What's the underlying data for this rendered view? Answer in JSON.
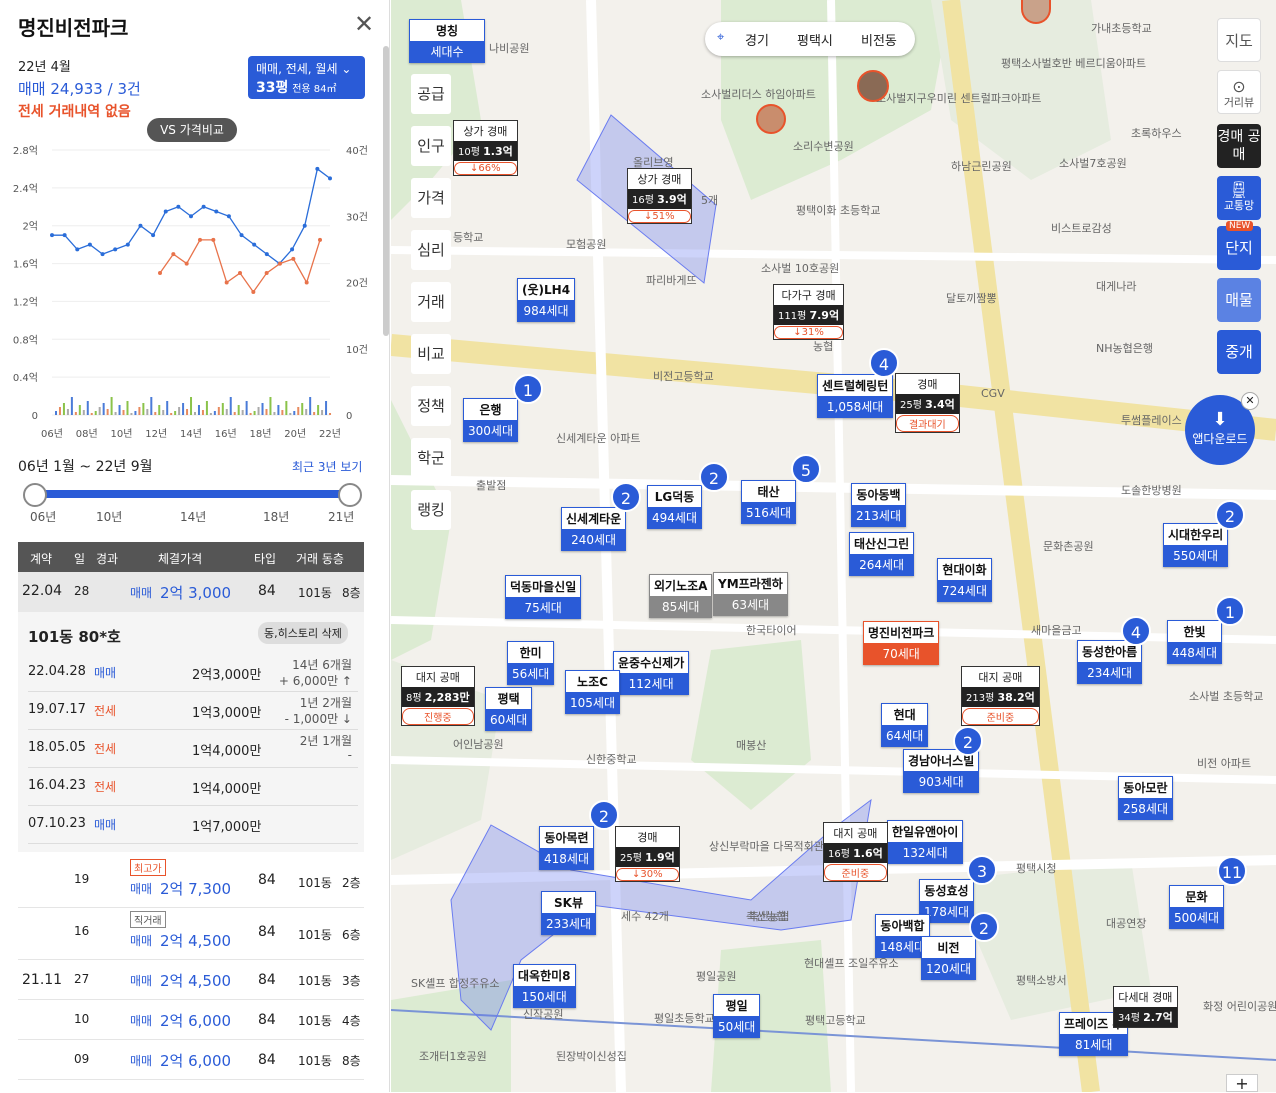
{
  "panel": {
    "title": "명진비전파크",
    "summary": {
      "date": "22년 4월",
      "trade": "매매 24,933 / 3건",
      "lease": "전세 거래내역 없음"
    },
    "typebox": {
      "types": "매매, 전세, 월세",
      "size": "33평",
      "area": "전용 84㎡"
    },
    "vs_button": "VS 가격비교",
    "range": {
      "label": "06년 1월 ~ 22년 9월",
      "link": "최근 3년 보기",
      "ticks": [
        "06년",
        "10년",
        "14년",
        "18년",
        "21년"
      ]
    },
    "table_headers": [
      "계약",
      "일",
      "경과",
      "체결가격",
      "타입",
      "거래 동층"
    ],
    "selected_row": {
      "month": "22.04",
      "day": "28",
      "type": "매매",
      "price": "2억 3,000",
      "size": "84",
      "dong": "101동",
      "floor": "8층"
    },
    "detail": {
      "title": "101동 80*호",
      "action": "동,히스토리 삭제",
      "rows": [
        {
          "date": "22.04.28",
          "type": "매매",
          "price": "2억3,000만",
          "gap": "14년 6개월",
          "diff": "+ 6,000만 ↑"
        },
        {
          "date": "19.07.17",
          "type": "전세",
          "price": "1억3,000만",
          "gap": "1년 2개월",
          "diff": "- 1,000만 ↓"
        },
        {
          "date": "18.05.05",
          "type": "전세",
          "price": "1억4,000만",
          "gap": "2년 1개월",
          "diff": "-"
        },
        {
          "date": "16.04.23",
          "type": "전세",
          "price": "1억4,000만",
          "gap": "",
          "diff": ""
        },
        {
          "date": "07.10.23",
          "type": "매매",
          "price": "1억7,000만",
          "gap": "",
          "diff": ""
        }
      ]
    },
    "group_month": "21.11",
    "rows": [
      {
        "day": "19",
        "badge": "최고가",
        "type": "매매",
        "price": "2억 7,300",
        "size": "84",
        "dong": "101동",
        "floor": "2층"
      },
      {
        "day": "16",
        "badge": "직거래",
        "type": "매매",
        "price": "2억 4,500",
        "size": "84",
        "dong": "101동",
        "floor": "6층"
      },
      {
        "day": "27",
        "badge": "",
        "type": "매매",
        "price": "2억 4,500",
        "size": "84",
        "dong": "101동",
        "floor": "3층"
      },
      {
        "day": "10",
        "badge": "",
        "type": "매매",
        "price": "2억 6,000",
        "size": "84",
        "dong": "101동",
        "floor": "4층"
      },
      {
        "day": "09",
        "badge": "",
        "type": "매매",
        "price": "2억 6,000",
        "size": "84",
        "dong": "101동",
        "floor": "8층"
      }
    ]
  },
  "chart_data": {
    "type": "line",
    "x": [
      "06년",
      "08년",
      "10년",
      "12년",
      "14년",
      "16년",
      "18년",
      "20년",
      "22년"
    ],
    "ylabel_left": [
      "2.8억",
      "2.4억",
      "2억",
      "1.6억",
      "1.2억",
      "0.8억",
      "0.4억",
      "0"
    ],
    "ylabel_right": [
      "40건",
      "30건",
      "20건",
      "10건",
      "0"
    ],
    "series": [
      {
        "values": [
          1.9,
          1.9,
          1.75,
          1.8,
          1.7,
          1.75,
          1.8,
          2.0,
          1.9,
          2.15,
          2.2,
          2.1,
          2.2,
          2.15,
          2.1,
          1.9,
          1.8,
          1.7,
          1.6,
          1.75,
          2.0,
          2.6,
          2.5
        ],
        "color": "#2a6dd9"
      },
      {
        "values": [
          1.5,
          1.7,
          1.6,
          1.85,
          1.85,
          1.4,
          1.5,
          1.3,
          1.5,
          1.6,
          1.65,
          1.4,
          1.85
        ],
        "color": "#e8734b"
      }
    ]
  },
  "map": {
    "toolbar": [
      "경기",
      "평택시",
      "비전동"
    ],
    "legend": {
      "name": "명칭",
      "count": "세대수"
    },
    "side": [
      "공급",
      "인구",
      "가격",
      "심리",
      "거래",
      "비교",
      "정책",
      "학군",
      "랭킹"
    ],
    "right": [
      "지도",
      "거리뷰",
      "경매 공매",
      "교통망",
      "단지",
      "매물",
      "중개",
      "앱다운로드"
    ],
    "new_label": "NEW",
    "markers": [
      {
        "name": "(웃)LH4",
        "count": "984세대"
      },
      {
        "name": "은행",
        "count": "300세대"
      },
      {
        "name": "신세계타운",
        "count": "240세대"
      },
      {
        "name": "LG덕동",
        "count": "494세대"
      },
      {
        "name": "태산",
        "count": "516세대"
      },
      {
        "name": "동아동백",
        "count": "213세대"
      },
      {
        "name": "태산신그린",
        "count": "264세대"
      },
      {
        "name": "현대이화",
        "count": "724세대"
      },
      {
        "name": "센트럴헤링턴",
        "count": "1,058세대"
      },
      {
        "name": "덕동마을신일",
        "count": "75세대"
      },
      {
        "name": "외기노조A",
        "count": "85세대"
      },
      {
        "name": "YM프라젠하",
        "count": "63세대"
      },
      {
        "name": "한미",
        "count": "56세대"
      },
      {
        "name": "윤중수신제가",
        "count": "112세대"
      },
      {
        "name": "평택",
        "count": "60세대"
      },
      {
        "name": "노조C",
        "count": "105세대"
      },
      {
        "name": "명진비전파크",
        "count": "70세대"
      },
      {
        "name": "현대",
        "count": "64세대"
      },
      {
        "name": "경남아너스빌",
        "count": "903세대"
      },
      {
        "name": "시대한우리",
        "count": "550세대"
      },
      {
        "name": "한빛",
        "count": "448세대"
      },
      {
        "name": "동성한아름",
        "count": "234세대"
      },
      {
        "name": "동아모란",
        "count": "258세대"
      },
      {
        "name": "동아목련",
        "count": "418세대"
      },
      {
        "name": "SK뷰",
        "count": "233세대"
      },
      {
        "name": "한일유앤아이",
        "count": "132세대"
      },
      {
        "name": "동성효성",
        "count": "178세대"
      },
      {
        "name": "동아백합",
        "count": "148세대"
      },
      {
        "name": "비전",
        "count": "120세대"
      },
      {
        "name": "대옥한미8",
        "count": "150세대"
      },
      {
        "name": "평일",
        "count": "50세대"
      },
      {
        "name": "문화",
        "count": "500세대"
      },
      {
        "name": "프레이즈 주",
        "count": "81세대"
      }
    ],
    "auctions": [
      {
        "name": "상가 경매",
        "size": "10평",
        "price": "1.3억",
        "pct": "↓66%"
      },
      {
        "name": "상가 경매",
        "size": "16평",
        "price": "3.9억",
        "pct": "↓51%"
      },
      {
        "name": "다가구 경매",
        "size": "111평",
        "price": "7.9억",
        "pct": "↓31%"
      },
      {
        "name": "경매",
        "size": "25평",
        "price": "3.4억",
        "pct": "결과대기"
      },
      {
        "name": "대지 공매",
        "size": "8평",
        "price": "2,283만",
        "pct": "진행중"
      },
      {
        "name": "대지 공매",
        "size": "213평",
        "price": "38.2억",
        "pct": "준비중"
      },
      {
        "name": "경매",
        "size": "25평",
        "price": "1.9억",
        "pct": "↓30%"
      },
      {
        "name": "대지 공매",
        "size": "16평",
        "price": "1.6억",
        "pct": "준비중"
      },
      {
        "name": "다세대 경매",
        "size": "34평",
        "price": "2.7억",
        "pct": ""
      }
    ],
    "circles": [
      "1",
      "2",
      "2",
      "5",
      "4",
      "2",
      "1",
      "4",
      "2",
      "2",
      "3",
      "2",
      "11"
    ],
    "places": [
      "나비공원",
      "가내초등학교",
      "소사벌리더스 하임아파트",
      "소리수변공원",
      "소사벌지구우미린 센트럴파크아파트",
      "평택소사벌호반 베르디움아파트",
      "하남근린공원",
      "초록하우스",
      "소사벌7호공원",
      "평택이화 초등학교",
      "비스트로감성",
      "소사벌 10호공원",
      "달토끼짬뽕",
      "대게나라",
      "NH농협은행",
      "비전고등학교",
      "투썸플레이스",
      "도솔한방병원",
      "문화촌공원",
      "신세계타운 아파트",
      "출발점",
      "한국타이어",
      "새마을금고",
      "소사벌 초등학교",
      "매봉산",
      "신한중학교",
      "어인남공원",
      "상신부락마을 다목적회관",
      "평택시청",
      "대공연장",
      "평일공원",
      "평택소방서",
      "평택고등학교",
      "조개터1호공원",
      "신작공원",
      "화정 어린이공원",
      "축산농협",
      "모험공원",
      "파리바게뜨",
      "올리브영",
      "농협",
      "CGV",
      "등학교",
      "SK셸프 합정주유소",
      "된장박이신성집",
      "현대셸프 조일주유소",
      "평일초등학교",
      "세수 42개",
      "5개",
      "축산농협",
      "비전 아파트"
    ]
  }
}
